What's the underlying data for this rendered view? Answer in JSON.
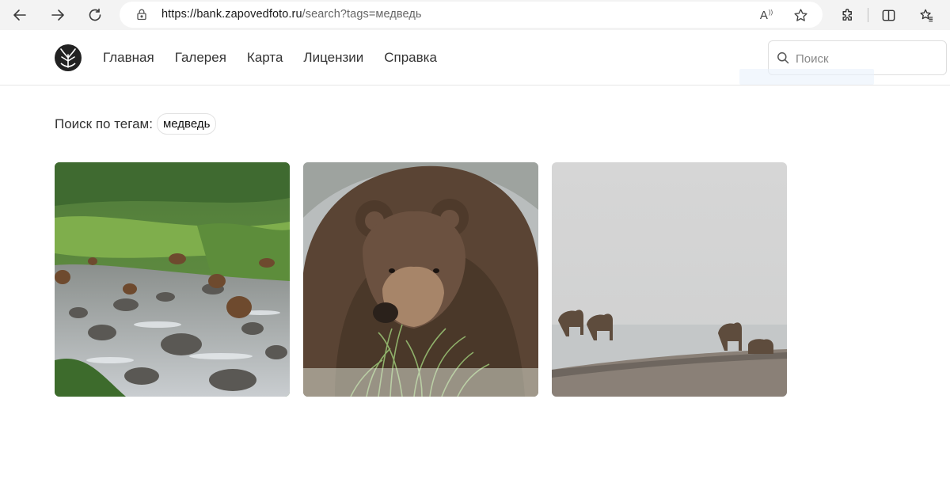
{
  "browser": {
    "url_host": "https://bank.zapovedfoto.ru",
    "url_path": "/search?tags=медведь",
    "read_aloud_label": "A"
  },
  "site": {
    "menu": [
      {
        "label": "Главная"
      },
      {
        "label": "Галерея"
      },
      {
        "label": "Карта"
      },
      {
        "label": "Лицензии"
      },
      {
        "label": "Справка"
      }
    ],
    "search_placeholder": "Поиск"
  },
  "content": {
    "tag_search_label": "Поиск по тегам:",
    "tag": "медведь",
    "photos": [
      {
        "subject": "bears-in-river-photo"
      },
      {
        "subject": "bear-closeup-photo"
      },
      {
        "subject": "bears-in-fog-photo"
      }
    ]
  },
  "icons": [
    "back-icon",
    "forward-icon",
    "reload-icon",
    "lock-icon",
    "read-aloud-icon",
    "favorite-star-icon",
    "extensions-icon",
    "split-screen-icon",
    "favorites-icon",
    "search-icon",
    "site-logo-icon"
  ]
}
